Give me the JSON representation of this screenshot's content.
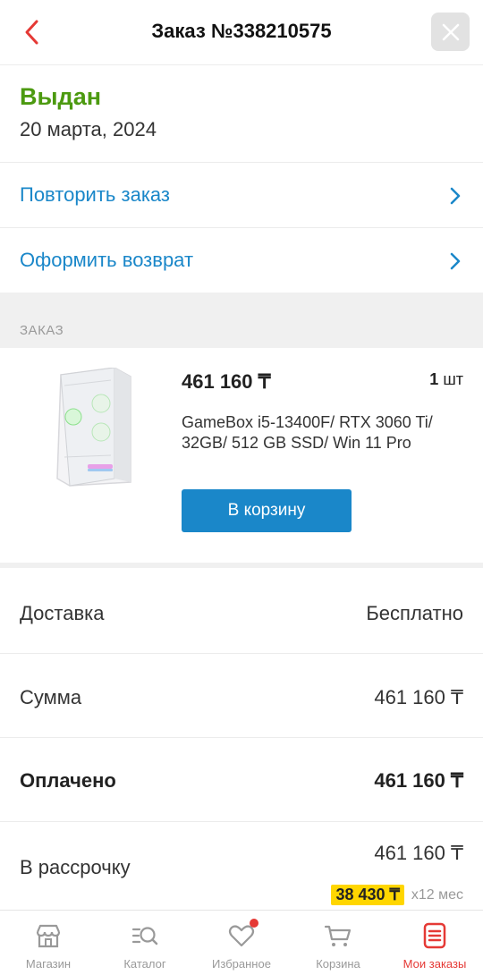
{
  "header": {
    "title": "Заказ №338210575"
  },
  "order": {
    "status": "Выдан",
    "date": "20 марта, 2024",
    "actions": {
      "repeat": "Повторить заказ",
      "return": "Оформить возврат"
    }
  },
  "section": {
    "label": "ЗАКАЗ"
  },
  "product": {
    "price": "461 160 ₸",
    "qty_number": "1",
    "qty_unit": "шт",
    "name": "GameBox i5-13400F/ RTX 3060 Ti/ 32GB/ 512 GB SSD/ Win 11 Pro",
    "cart_button": "В корзину"
  },
  "summary": {
    "delivery_label": "Доставка",
    "delivery_value": "Бесплатно",
    "sum_label": "Сумма",
    "sum_value": "461 160 ₸",
    "paid_label": "Оплачено",
    "paid_value": "461 160 ₸",
    "installment_label": "В рассрочку",
    "installment_value": "461 160 ₸",
    "installment_monthly": "38 430 ₸",
    "installment_term": "х12 мес"
  },
  "tabs": [
    {
      "label": "Магазин",
      "icon": "store-icon"
    },
    {
      "label": "Каталог",
      "icon": "catalog-search-icon"
    },
    {
      "label": "Избранное",
      "icon": "heart-icon"
    },
    {
      "label": "Корзина",
      "icon": "cart-icon"
    },
    {
      "label": "Мои заказы",
      "icon": "orders-icon",
      "active": true
    }
  ],
  "colors": {
    "accent_blue": "#1a87c9",
    "status_green": "#4c9a10",
    "active_red": "#e53935",
    "badge_yellow": "#ffd600"
  }
}
